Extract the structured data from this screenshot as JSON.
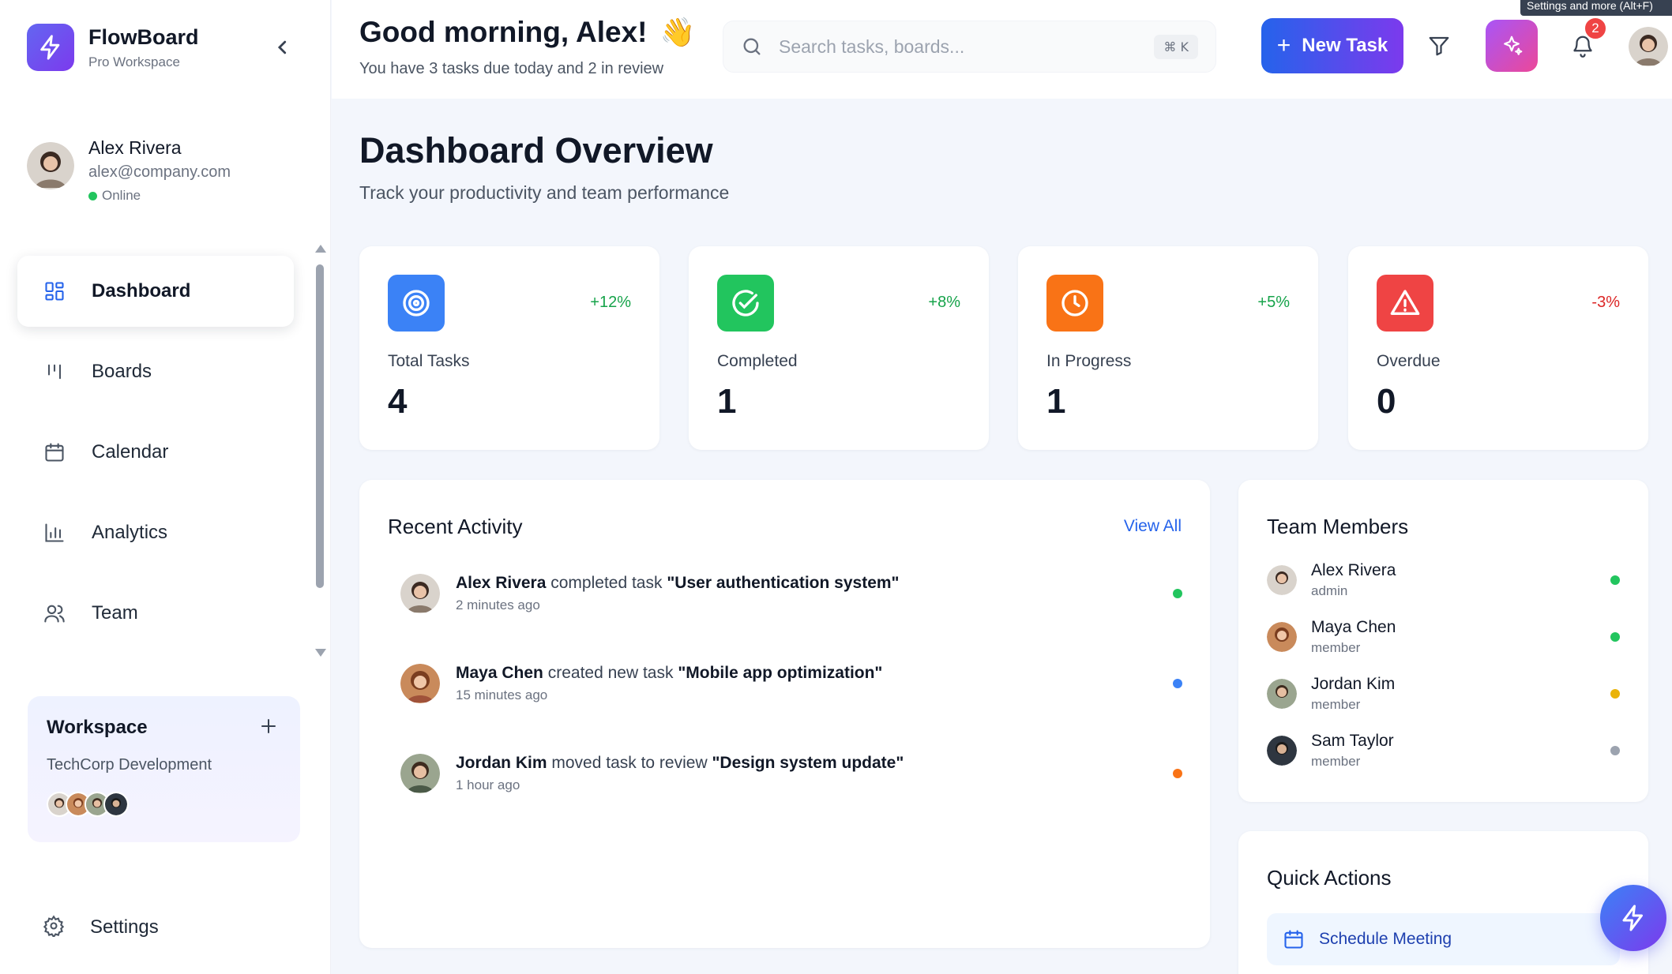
{
  "brand": {
    "name": "FlowBoard",
    "subtitle": "Pro Workspace"
  },
  "profile": {
    "name": "Alex Rivera",
    "email": "alex@company.com",
    "status": "Online"
  },
  "sidebar": {
    "items": [
      {
        "label": "Dashboard",
        "icon": "grid-icon",
        "active": true
      },
      {
        "label": "Boards",
        "icon": "kanban-icon"
      },
      {
        "label": "Calendar",
        "icon": "calendar-icon"
      },
      {
        "label": "Analytics",
        "icon": "bar-chart-icon"
      },
      {
        "label": "Team",
        "icon": "users-icon"
      }
    ],
    "settings_label": "Settings"
  },
  "workspace": {
    "title": "Workspace",
    "name": "TechCorp Development"
  },
  "header": {
    "greeting": "Good morning, Alex!",
    "wave": "👋",
    "subtext": "You have 3 tasks due today and 2 in review",
    "search_placeholder": "Search tasks, boards...",
    "shortcut": "⌘ K",
    "new_task_label": "New Task",
    "notification_count": "2",
    "tooltip": "Settings and more (Alt+F)"
  },
  "page": {
    "title": "Dashboard Overview",
    "subtitle": "Track your productivity and team performance"
  },
  "stats": [
    {
      "label": "Total Tasks",
      "value": "4",
      "change": "+12%",
      "color": "#3b82f6",
      "change_color": "#16a34a",
      "icon": "target-icon"
    },
    {
      "label": "Completed",
      "value": "1",
      "change": "+8%",
      "color": "#22c55e",
      "change_color": "#16a34a",
      "icon": "check-circle-icon"
    },
    {
      "label": "In Progress",
      "value": "1",
      "change": "+5%",
      "color": "#f97316",
      "change_color": "#16a34a",
      "icon": "clock-icon"
    },
    {
      "label": "Overdue",
      "value": "0",
      "change": "-3%",
      "color": "#ef4444",
      "change_color": "#dc2626",
      "icon": "alert-triangle-icon"
    }
  ],
  "activity": {
    "title": "Recent Activity",
    "view_all": "View All",
    "items": [
      {
        "user": "Alex Rivera",
        "action": "completed task",
        "task": "\"User authentication system\"",
        "time": "2 minutes ago",
        "dot": "#22c55e"
      },
      {
        "user": "Maya Chen",
        "action": "created new task",
        "task": "\"Mobile app optimization\"",
        "time": "15 minutes ago",
        "dot": "#3b82f6"
      },
      {
        "user": "Jordan Kim",
        "action": "moved task to review",
        "task": "\"Design system update\"",
        "time": "1 hour ago",
        "dot": "#f97316"
      }
    ]
  },
  "team": {
    "title": "Team Members",
    "members": [
      {
        "name": "Alex Rivera",
        "role": "admin",
        "status": "#22c55e"
      },
      {
        "name": "Maya Chen",
        "role": "member",
        "status": "#22c55e"
      },
      {
        "name": "Jordan Kim",
        "role": "member",
        "status": "#eab308"
      },
      {
        "name": "Sam Taylor",
        "role": "member",
        "status": "#9ca3af"
      }
    ]
  },
  "quick_actions": {
    "title": "Quick Actions",
    "items": [
      {
        "label": "Schedule Meeting"
      }
    ]
  }
}
